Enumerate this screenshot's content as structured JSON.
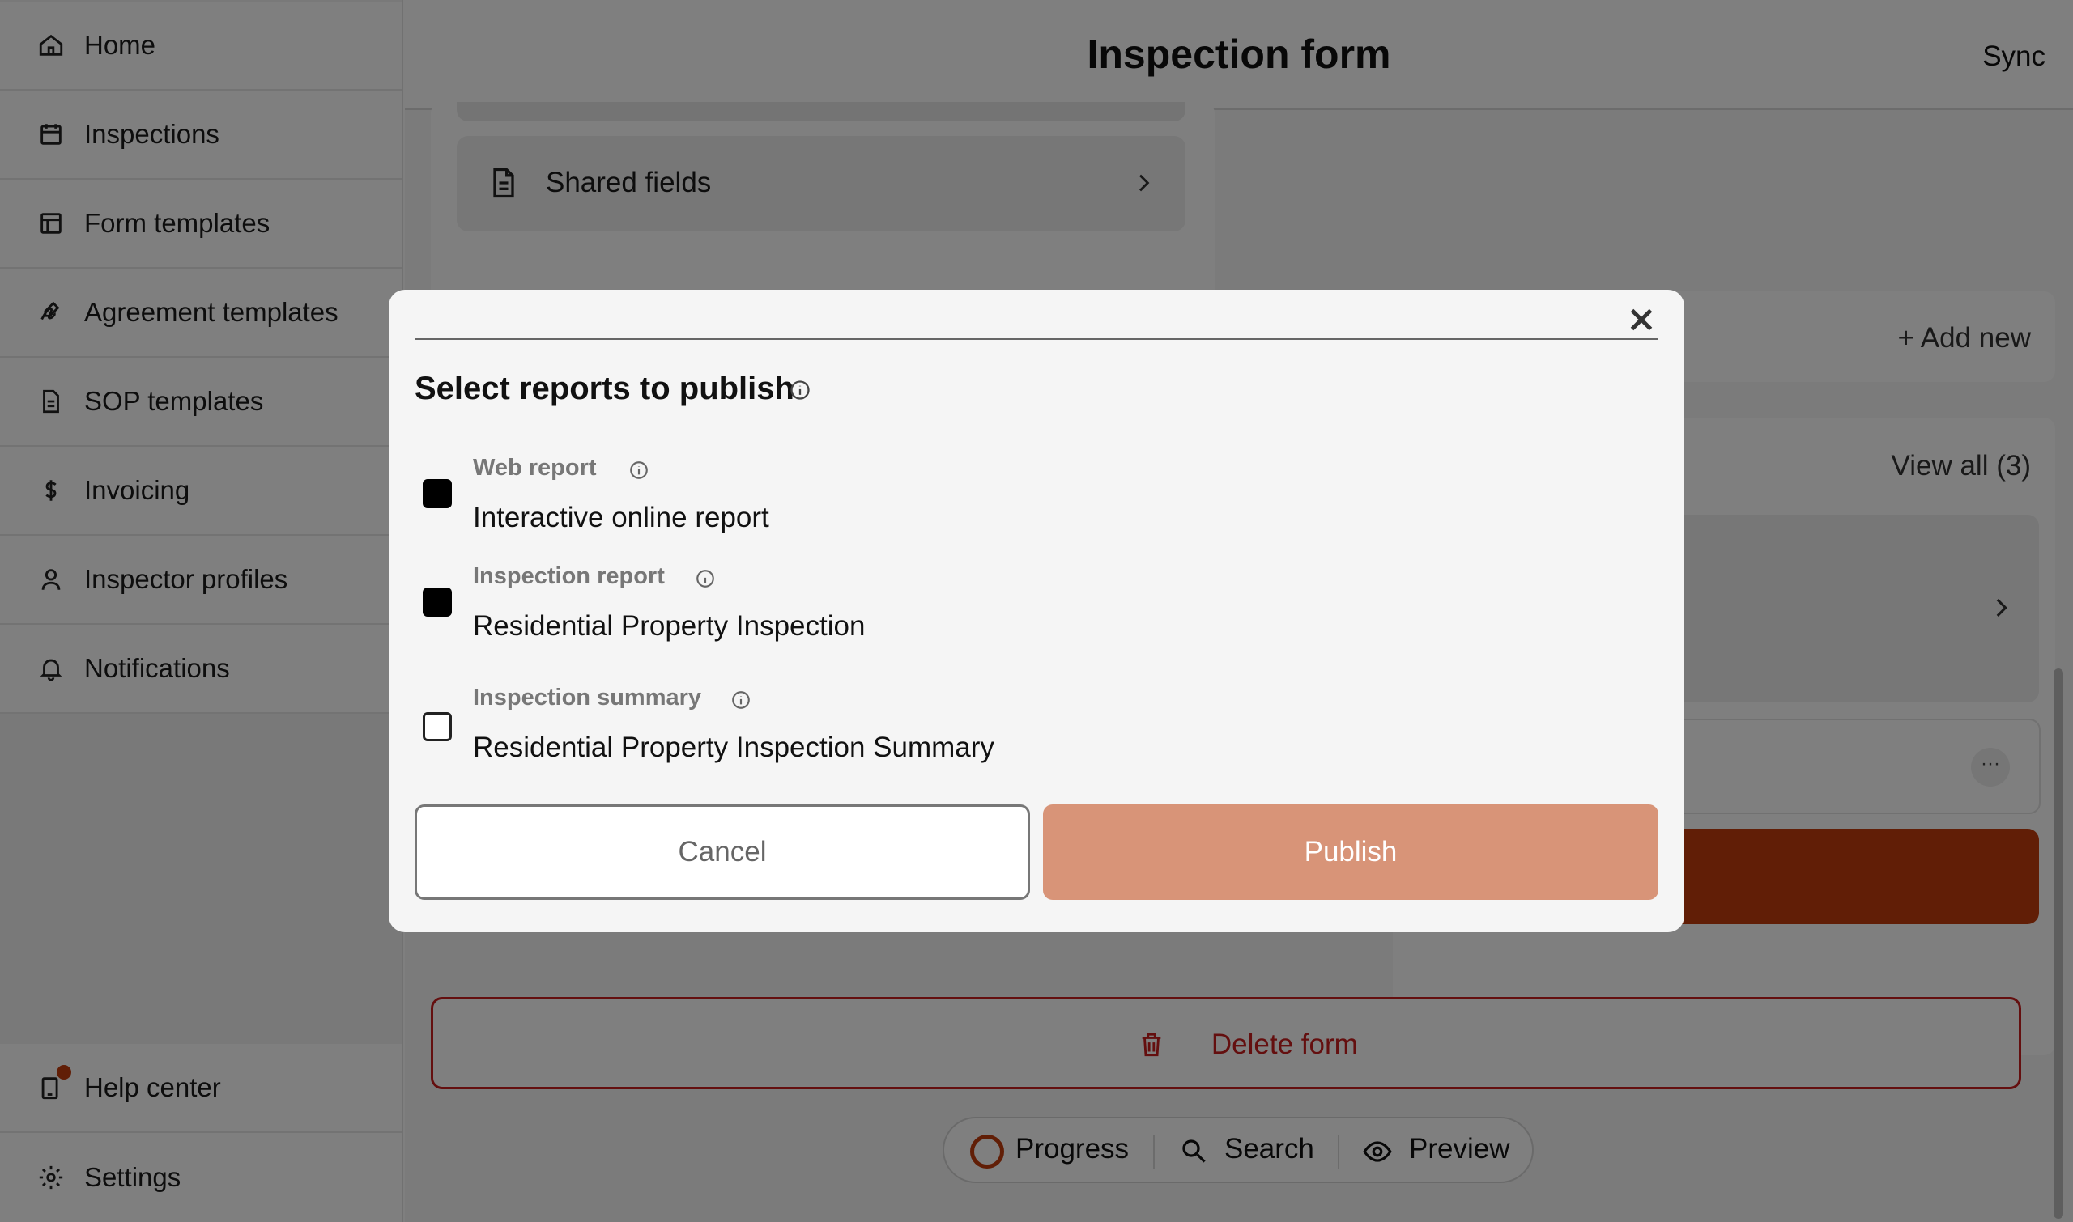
{
  "sidebar": {
    "items": [
      {
        "label": "Home",
        "icon": "home-icon"
      },
      {
        "label": "Inspections",
        "icon": "calendar-icon"
      },
      {
        "label": "Form templates",
        "icon": "layout-icon"
      },
      {
        "label": "Agreement templates",
        "icon": "signature-icon"
      },
      {
        "label": "SOP templates",
        "icon": "document-icon"
      },
      {
        "label": "Invoicing",
        "icon": "dollar-icon"
      },
      {
        "label": "Inspector profiles",
        "icon": "user-icon"
      },
      {
        "label": "Notifications",
        "icon": "bell-icon"
      }
    ],
    "bottom": [
      {
        "label": "Help center",
        "icon": "help-device-icon"
      },
      {
        "label": "Settings",
        "icon": "gear-icon"
      }
    ]
  },
  "header": {
    "title": "Inspection form",
    "sync_label": "Sync"
  },
  "main": {
    "shared_fields_label": "Shared fields",
    "add_new_label": "+ Add new",
    "view_all_label": "View all (3)",
    "more_label": "···",
    "delete_label": "Delete form"
  },
  "bottom_bar": {
    "progress": "Progress",
    "search": "Search",
    "preview": "Preview"
  },
  "modal": {
    "title": "Select reports to publish",
    "options": [
      {
        "name": "Web report",
        "desc": "Interactive online report",
        "checked": true
      },
      {
        "name": "Inspection report",
        "desc": "Residential Property Inspection",
        "checked": true
      },
      {
        "name": "Inspection summary",
        "desc": "Residential Property Inspection Summary",
        "checked": false
      }
    ],
    "cancel_label": "Cancel",
    "publish_label": "Publish"
  },
  "colors": {
    "accent": "#c23c0d",
    "publish": "#d89478",
    "danger": "#c81e1e"
  }
}
